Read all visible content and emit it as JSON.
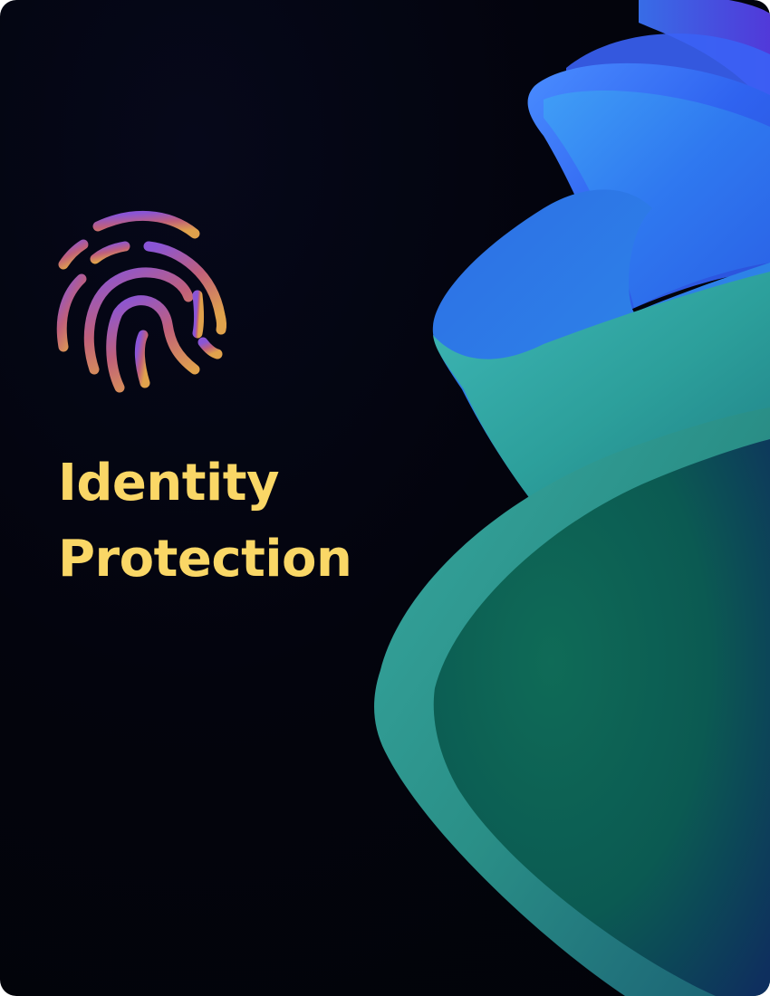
{
  "card": {
    "title_line1": "Identity",
    "title_line2": "Protection",
    "icon": "fingerprint-icon",
    "colors": {
      "background": "#03040d",
      "title": "#fad766",
      "icon_gradient_start": "#8a55d6",
      "icon_gradient_mid": "#c0607a",
      "icon_gradient_end": "#e0a24c",
      "artwork_blue": "#2f7cf0",
      "artwork_teal": "#2aa59a",
      "artwork_green": "#0f6b57"
    }
  }
}
